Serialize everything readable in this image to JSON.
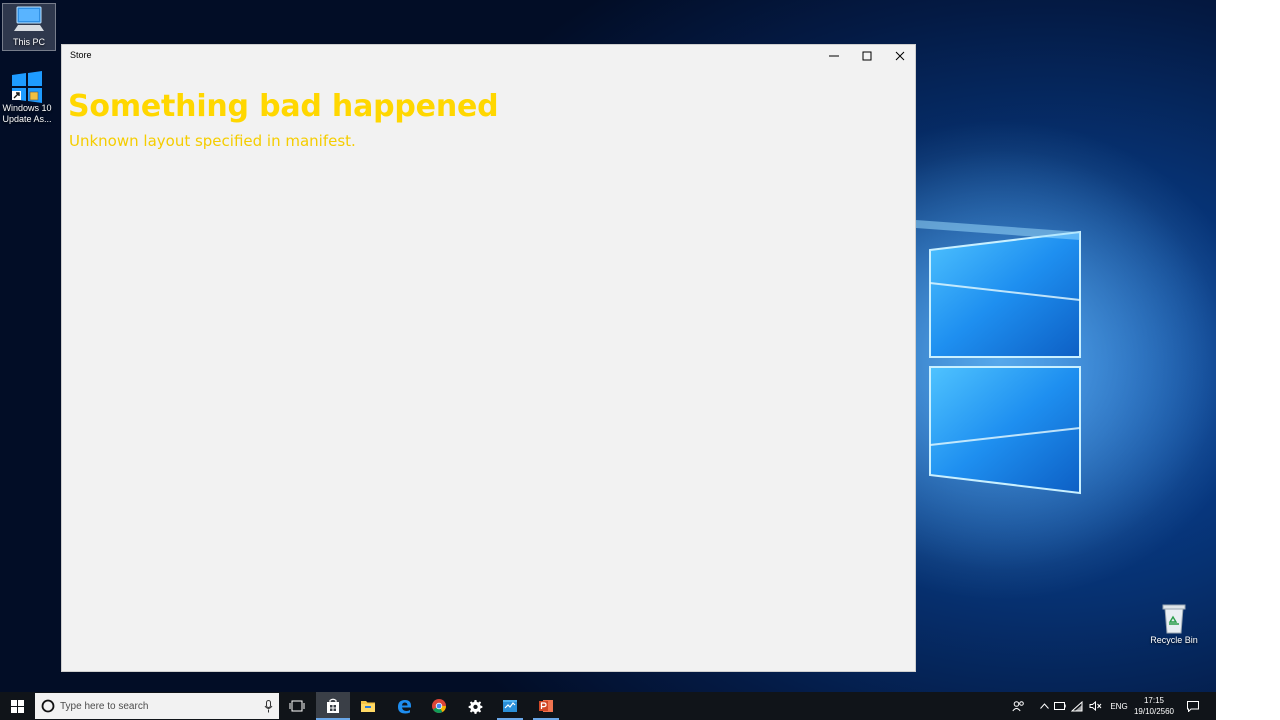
{
  "desktop": {
    "icons": [
      {
        "label": "This PC"
      },
      {
        "label": "Windows 10 Update As..."
      },
      {
        "label": "Recycle Bin"
      }
    ]
  },
  "window": {
    "title": "Store",
    "heading": "Something bad happened",
    "message": "Unknown layout specified in manifest."
  },
  "taskbar": {
    "search_placeholder": "Type here to search",
    "language": "ENG",
    "time": "17:15",
    "date": "19/10/2560"
  },
  "colors": {
    "error_text": "#ffd700",
    "window_bg": "#f2f2f2",
    "taskbar_bg": "#101419",
    "accent": "#0078d7"
  },
  "icons": {
    "start": "windows-logo-icon",
    "search": "cortana-circle-icon",
    "mic": "microphone-icon",
    "task_view": "task-view-icon",
    "apps": [
      "store-icon",
      "file-explorer-icon",
      "edge-icon",
      "chrome-icon",
      "settings-gear-icon",
      "app-icon",
      "powerpoint-icon"
    ],
    "tray": [
      "people-icon",
      "chevron-up-icon",
      "battery-icon",
      "wifi-icon",
      "volume-muted-icon",
      "action-center-icon"
    ]
  }
}
